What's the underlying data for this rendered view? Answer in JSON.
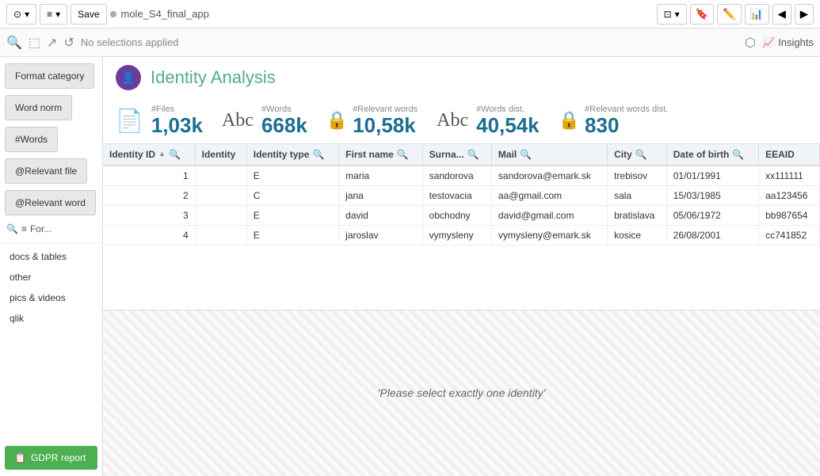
{
  "toolbar": {
    "save_label": "Save",
    "app_name": "mole_S4_final_app",
    "insights_label": "Insights"
  },
  "selection_bar": {
    "no_selections": "No selections applied"
  },
  "sidebar": {
    "buttons": [
      {
        "id": "format-category",
        "label": "Format category"
      },
      {
        "id": "word-norm",
        "label": "Word norm"
      },
      {
        "id": "words",
        "label": "#Words"
      },
      {
        "id": "relevant-file",
        "label": "@Relevant file"
      },
      {
        "id": "relevant-word",
        "label": "@Relevant word"
      }
    ],
    "search_placeholder": "For...",
    "links": [
      {
        "id": "docs-tables",
        "label": "docs & tables"
      },
      {
        "id": "other",
        "label": "other"
      },
      {
        "id": "pics-videos",
        "label": "pics & videos"
      },
      {
        "id": "qlik",
        "label": "qlik"
      }
    ],
    "gdpr_button": "GDPR report"
  },
  "page_header": {
    "title": "Identity Analysis",
    "icon": "👤"
  },
  "stats": [
    {
      "id": "files",
      "label": "#Files",
      "value": "1,03k",
      "icon_type": "document"
    },
    {
      "id": "words",
      "label": "#Words",
      "value": "668k",
      "icon_type": "abc"
    },
    {
      "id": "relevant_words",
      "label": "#Relevant words",
      "value": "10,58k",
      "icon_type": "lock"
    },
    {
      "id": "words_dist",
      "label": "#Words dist.",
      "value": "40,54k",
      "icon_type": "abc"
    },
    {
      "id": "relevant_words_dist",
      "label": "#Relevant words dist.",
      "value": "830",
      "icon_type": "lock"
    }
  ],
  "table": {
    "columns": [
      {
        "id": "identity-id",
        "label": "Identity ID",
        "sortable": true,
        "sorted": "asc",
        "searchable": true
      },
      {
        "id": "identity",
        "label": "Identity",
        "sortable": false,
        "searchable": false
      },
      {
        "id": "identity-type",
        "label": "Identity type",
        "sortable": false,
        "searchable": true
      },
      {
        "id": "first-name",
        "label": "First name",
        "sortable": false,
        "searchable": true
      },
      {
        "id": "surname",
        "label": "Surna...",
        "sortable": false,
        "searchable": true
      },
      {
        "id": "mail",
        "label": "Mail",
        "sortable": false,
        "searchable": true
      },
      {
        "id": "city",
        "label": "City",
        "sortable": false,
        "searchable": true
      },
      {
        "id": "date-of-birth",
        "label": "Date of birth",
        "sortable": false,
        "searchable": true
      },
      {
        "id": "eeaid",
        "label": "EEAID",
        "sortable": false,
        "searchable": false
      }
    ],
    "rows": [
      {
        "id": 1,
        "identity": "",
        "type": "E",
        "first_name": "maria",
        "surname": "sandorova",
        "mail": "sandorova@emark.sk",
        "city": "trebisov",
        "dob": "01/01/1991",
        "eeaid": "xx111111"
      },
      {
        "id": 2,
        "identity": "",
        "type": "C",
        "first_name": "jana",
        "surname": "testovacia",
        "mail": "aa@gmail.com",
        "city": "sala",
        "dob": "15/03/1985",
        "eeaid": "aa123456"
      },
      {
        "id": 3,
        "identity": "",
        "type": "E",
        "first_name": "david",
        "surname": "obchodny",
        "mail": "david@gmail.com",
        "city": "bratislava",
        "dob": "05/06/1972",
        "eeaid": "bb987654"
      },
      {
        "id": 4,
        "identity": "",
        "type": "E",
        "first_name": "jaroslav",
        "surname": "vymysleny",
        "mail": "vymysleny@emark.sk",
        "city": "kosice",
        "dob": "26/08/2001",
        "eeaid": "cc741852"
      }
    ]
  },
  "lower_panel": {
    "message": "'Please select exactly one identity'"
  }
}
